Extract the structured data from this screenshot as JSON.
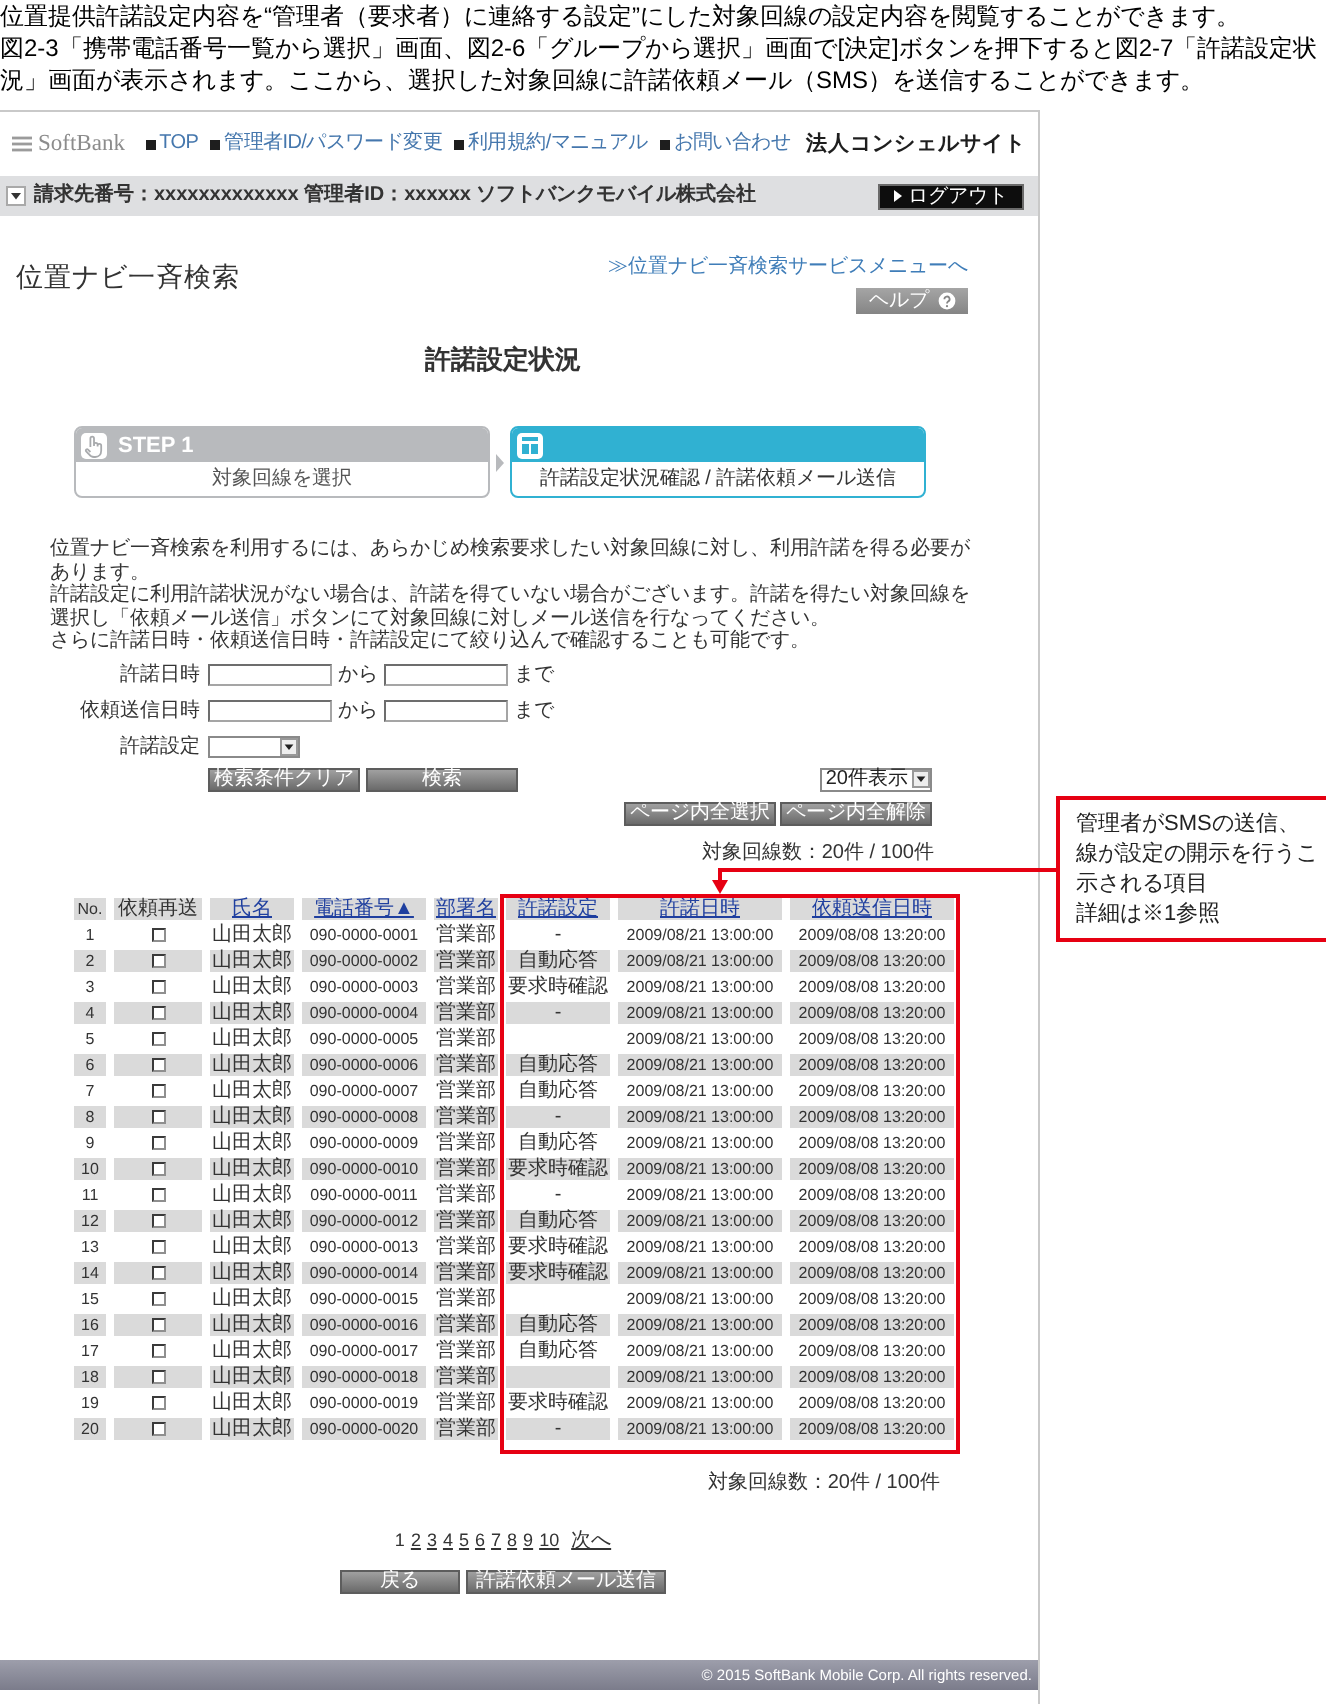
{
  "intro": [
    "位置提供許諾設定内容を“管理者（要求者）に連絡する設定”にした対象回線の設定内容を閲覧することができます。",
    "図2-3「携帯電話番号一覧から選択」画面、図2-6「グループから選択」画面で[決定]ボタンを押下すると図2-7「許諾設定状況」画面が表示されます。ここから、選択した対象回線に許諾依頼メール（SMS）を送信することができます。"
  ],
  "screen": {
    "header": {
      "logo": "SoftBank",
      "nav": [
        "TOP",
        "管理者ID/パスワード変更",
        "利用規約/マニュアル",
        "お問い合わせ"
      ],
      "site_name": "法人コンシェルサイト"
    },
    "account_bar": {
      "info": "請求先番号：xxxxxxxxxxxxx 管理者ID：xxxxxx ソフトバンクモバイル株式会社",
      "logout": "ログアウト"
    },
    "page_title": "位置ナビ一斉検索",
    "menu_link": "≫位置ナビ一斉検索サービスメニューへ",
    "help_button": "ヘルプ",
    "heading": "許諾設定状況",
    "steps": [
      {
        "label": "STEP 1",
        "caption": "対象回線を選択",
        "selected": false
      },
      {
        "caption": "許諾設定状況確認 / 許諾依頼メール送信",
        "selected": true
      }
    ],
    "description": [
      "位置ナビ一斉検索を利用するには、あらかじめ検索要求したい対象回線に対し、利用許諾を得る必要があります。",
      "許諾設定に利用許諾状況がない場合は、許諾を得ていない場合がございます。許諾を得たい対象回線を選択し「依頼メール送信」ボタンにて対象回線に対しメール送信を行なってください。",
      "さらに許諾日時・依頼送信日時・許諾設定にて絞り込んで確認することも可能です。"
    ],
    "filters": [
      {
        "kind": "range",
        "label": "許諾日時",
        "between": "から",
        "after": "まで"
      },
      {
        "kind": "range",
        "label": "依頼送信日時",
        "between": "から",
        "after": "まで"
      },
      {
        "kind": "select",
        "label": "許諾設定"
      }
    ],
    "filter_buttons": [
      "検索条件クリア",
      "検索"
    ],
    "page_size": "20件表示",
    "selection_buttons": [
      "ページ内全選択",
      "ページ内全解除"
    ],
    "count_top": "対象回線数：20件 / 100件",
    "table": {
      "columns": [
        {
          "label": "No.",
          "kind": "text",
          "link": false,
          "highlighted": false
        },
        {
          "label": "依頼再送",
          "kind": "checkbox",
          "link": false,
          "highlighted": false
        },
        {
          "label": "氏名",
          "kind": "text",
          "link": true,
          "highlighted": false
        },
        {
          "label": "電話番号▲",
          "kind": "text",
          "link": true,
          "highlighted": false
        },
        {
          "label": "部署名",
          "kind": "text",
          "link": true,
          "highlighted": false
        },
        {
          "label": "許諾設定",
          "kind": "text",
          "link": true,
          "highlighted": true
        },
        {
          "label": "許諾日時",
          "kind": "text",
          "link": true,
          "highlighted": true
        },
        {
          "label": "依頼送信日時",
          "kind": "text",
          "link": true,
          "highlighted": true
        }
      ],
      "rows": [
        {
          "no": "1",
          "checked": false,
          "name": "山田太郎",
          "phone": "090-0000-0001",
          "department": "営業部",
          "consent": "-",
          "consent_time": "2009/08/21 13:00:00",
          "request_time": "2009/08/08 13:20:00"
        },
        {
          "no": "2",
          "checked": false,
          "name": "山田太郎",
          "phone": "090-0000-0002",
          "department": "営業部",
          "consent": "自動応答",
          "consent_time": "2009/08/21 13:00:00",
          "request_time": "2009/08/08 13:20:00"
        },
        {
          "no": "3",
          "checked": false,
          "name": "山田太郎",
          "phone": "090-0000-0003",
          "department": "営業部",
          "consent": "要求時確認",
          "consent_time": "2009/08/21 13:00:00",
          "request_time": "2009/08/08 13:20:00"
        },
        {
          "no": "4",
          "checked": false,
          "name": "山田太郎",
          "phone": "090-0000-0004",
          "department": "営業部",
          "consent": "-",
          "consent_time": "2009/08/21 13:00:00",
          "request_time": "2009/08/08 13:20:00"
        },
        {
          "no": "5",
          "checked": false,
          "name": "山田太郎",
          "phone": "090-0000-0005",
          "department": "営業部",
          "consent_time": "2009/08/21 13:00:00",
          "request_time": "2009/08/08 13:20:00"
        },
        {
          "no": "6",
          "checked": false,
          "name": "山田太郎",
          "phone": "090-0000-0006",
          "department": "営業部",
          "consent": "自動応答",
          "consent_time": "2009/08/21 13:00:00",
          "request_time": "2009/08/08 13:20:00"
        },
        {
          "no": "7",
          "checked": false,
          "name": "山田太郎",
          "phone": "090-0000-0007",
          "department": "営業部",
          "consent": "自動応答",
          "consent_time": "2009/08/21 13:00:00",
          "request_time": "2009/08/08 13:20:00"
        },
        {
          "no": "8",
          "checked": false,
          "name": "山田太郎",
          "phone": "090-0000-0008",
          "department": "営業部",
          "consent": "-",
          "consent_time": "2009/08/21 13:00:00",
          "request_time": "2009/08/08 13:20:00"
        },
        {
          "no": "9",
          "checked": false,
          "name": "山田太郎",
          "phone": "090-0000-0009",
          "department": "営業部",
          "consent": "自動応答",
          "consent_time": "2009/08/21 13:00:00",
          "request_time": "2009/08/08 13:20:00"
        },
        {
          "no": "10",
          "checked": false,
          "name": "山田太郎",
          "phone": "090-0000-0010",
          "department": "営業部",
          "consent": "要求時確認",
          "consent_time": "2009/08/21 13:00:00",
          "request_time": "2009/08/08 13:20:00"
        },
        {
          "no": "11",
          "checked": false,
          "name": "山田太郎",
          "phone": "090-0000-0011",
          "department": "営業部",
          "consent": "-",
          "consent_time": "2009/08/21 13:00:00",
          "request_time": "2009/08/08 13:20:00"
        },
        {
          "no": "12",
          "checked": false,
          "name": "山田太郎",
          "phone": "090-0000-0012",
          "department": "営業部",
          "consent": "自動応答",
          "consent_time": "2009/08/21 13:00:00",
          "request_time": "2009/08/08 13:20:00"
        },
        {
          "no": "13",
          "checked": false,
          "name": "山田太郎",
          "phone": "090-0000-0013",
          "department": "営業部",
          "consent": "要求時確認",
          "consent_time": "2009/08/21 13:00:00",
          "request_time": "2009/08/08 13:20:00"
        },
        {
          "no": "14",
          "checked": false,
          "name": "山田太郎",
          "phone": "090-0000-0014",
          "department": "営業部",
          "consent": "要求時確認",
          "consent_time": "2009/08/21 13:00:00",
          "request_time": "2009/08/08 13:20:00"
        },
        {
          "no": "15",
          "checked": false,
          "name": "山田太郎",
          "phone": "090-0000-0015",
          "department": "営業部",
          "consent_time": "2009/08/21 13:00:00",
          "request_time": "2009/08/08 13:20:00"
        },
        {
          "no": "16",
          "checked": false,
          "name": "山田太郎",
          "phone": "090-0000-0016",
          "department": "営業部",
          "consent": "自動応答",
          "consent_time": "2009/08/21 13:00:00",
          "request_time": "2009/08/08 13:20:00"
        },
        {
          "no": "17",
          "checked": false,
          "name": "山田太郎",
          "phone": "090-0000-0017",
          "department": "営業部",
          "consent": "自動応答",
          "consent_time": "2009/08/21 13:00:00",
          "request_time": "2009/08/08 13:20:00"
        },
        {
          "no": "18",
          "checked": false,
          "name": "山田太郎",
          "phone": "090-0000-0018",
          "department": "営業部",
          "consent_time": "2009/08/21 13:00:00",
          "request_time": "2009/08/08 13:20:00"
        },
        {
          "no": "19",
          "checked": false,
          "name": "山田太郎",
          "phone": "090-0000-0019",
          "department": "営業部",
          "consent": "要求時確認",
          "consent_time": "2009/08/21 13:00:00",
          "request_time": "2009/08/08 13:20:00"
        },
        {
          "no": "20",
          "checked": false,
          "name": "山田太郎",
          "phone": "090-0000-0020",
          "department": "営業部",
          "consent": "-",
          "consent_time": "2009/08/21 13:00:00",
          "request_time": "2009/08/08 13:20:00"
        }
      ]
    },
    "count_bottom": "対象回線数：20件 / 100件",
    "pagination": {
      "pages": [
        {
          "label": "1",
          "selected": true
        },
        {
          "label": "2",
          "selected": false
        },
        {
          "label": "3",
          "selected": false
        },
        {
          "label": "4",
          "selected": false
        },
        {
          "label": "5",
          "selected": false
        },
        {
          "label": "6",
          "selected": false
        },
        {
          "label": "7",
          "selected": false
        },
        {
          "label": "8",
          "selected": false
        },
        {
          "label": "9",
          "selected": false
        },
        {
          "label": "10",
          "selected": false
        }
      ],
      "next": "次へ"
    },
    "buttons": [
      "戻る",
      "許諾依頼メール送信"
    ],
    "footer": "© 2015 SoftBank Mobile Corp. All rights reserved."
  },
  "annotation": {
    "lines": [
      "管理者がSMSの送信、",
      "線が設定の開示を行うこ",
      "示される項目",
      "詳細は※1参照"
    ]
  }
}
